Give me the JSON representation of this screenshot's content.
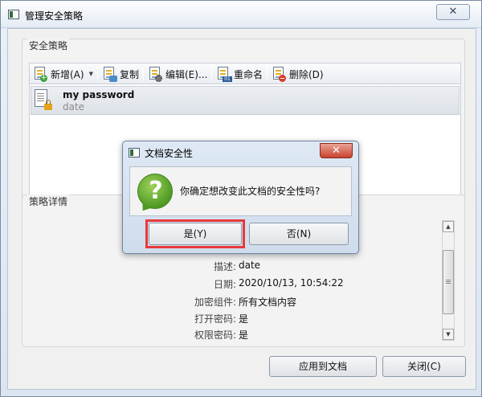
{
  "window": {
    "title": "管理安全策略",
    "close_glyph": "✕"
  },
  "policies_group": {
    "label": "安全策略"
  },
  "toolbar": {
    "new_label": "新增(A)",
    "copy_label": "复制",
    "edit_label": "编辑(E)...",
    "rename_label": "重命名",
    "delete_label": "删除(D)"
  },
  "policy_list": [
    {
      "name": "my password",
      "description": "date"
    }
  ],
  "details_group": {
    "label": "策略详情"
  },
  "details": [
    {
      "key": "描述:",
      "value": "date"
    },
    {
      "key": "日期:",
      "value": "2020/10/13, 10:54:22"
    },
    {
      "key": "加密组件:",
      "value": "所有文档内容"
    },
    {
      "key": "打开密码:",
      "value": "是"
    },
    {
      "key": "权限密码:",
      "value": "是"
    }
  ],
  "footer": {
    "apply_label": "应用到文档",
    "close_label": "关闭(C)"
  },
  "dialog": {
    "title": "文档安全性",
    "close_glyph": "✕",
    "icon_glyph": "?",
    "message": "你确定想改变此文档的安全性吗?",
    "yes_label": "是(Y)",
    "no_label": "否(N)"
  },
  "colors": {
    "highlight": "#e8393a",
    "dialog_close": "#c8432d",
    "question_icon": "#4f9a23"
  }
}
